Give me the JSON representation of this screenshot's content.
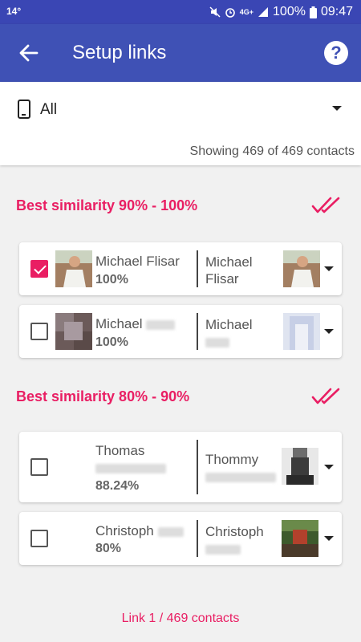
{
  "status_bar": {
    "temperature": "14°",
    "network": "4G+",
    "battery": "100%",
    "time": "09:47"
  },
  "app_bar": {
    "title": "Setup links",
    "back_icon": "arrow-back-icon",
    "help_icon": "help-circle-icon",
    "help_glyph": "?"
  },
  "filter": {
    "icon": "phone-icon",
    "selected": "All",
    "showing": "Showing 469 of 469 contacts"
  },
  "sections": [
    {
      "title": "Best similarity 90% - 100%",
      "contacts": [
        {
          "checked": true,
          "left_name_line1": "Michael Flisar",
          "percent": "100%",
          "right_name_line1": "Michael",
          "right_name_line2": "Flisar"
        },
        {
          "checked": false,
          "left_name_line1": "Michael",
          "percent": "100%",
          "right_name_line1": "Michael"
        }
      ]
    },
    {
      "title": "Best similarity 80% - 90%",
      "contacts": [
        {
          "checked": false,
          "left_name_line1": "Thomas",
          "percent": "88.24%",
          "right_name_line1": "Thommy"
        },
        {
          "checked": false,
          "left_name_line1": "Christoph",
          "percent": "80%",
          "right_name_line1": "Christoph"
        }
      ]
    }
  ],
  "footer": {
    "link_status": "Link 1 / 469 contacts"
  },
  "colors": {
    "primary": "#3f51b5",
    "accent": "#e91e63"
  }
}
